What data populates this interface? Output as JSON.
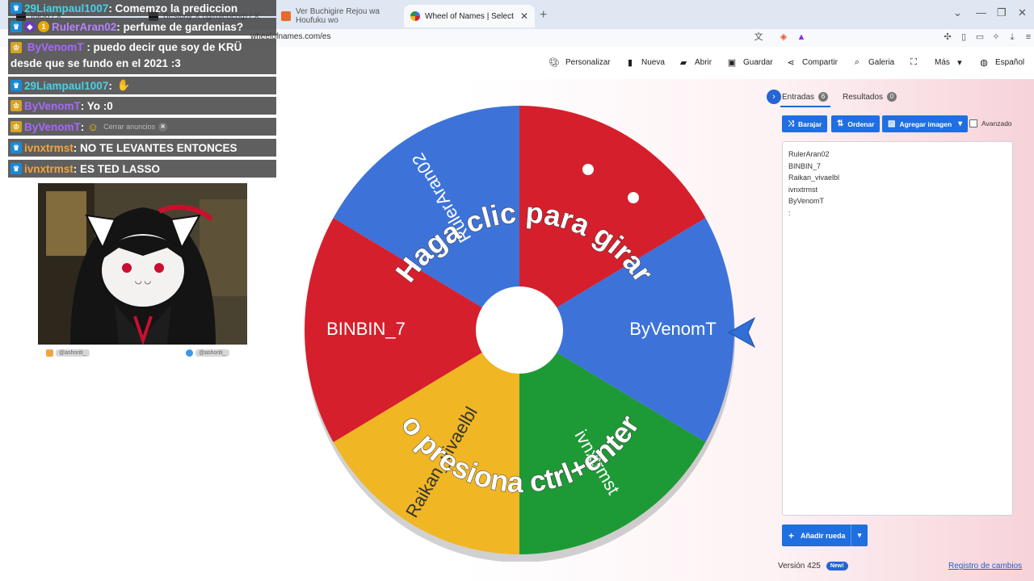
{
  "browser": {
    "tabs": [
      {
        "label": "Inicio / X",
        "active": false
      },
      {
        "label": "Bestboy X (@rolebeng) / X",
        "active": false
      },
      {
        "label": "Ver Buchigire Rejou wa Houfuku wo",
        "active": false
      },
      {
        "label": "Wheel of Names | Selector de n",
        "active": true
      }
    ],
    "url": "wheelofnames.com/es"
  },
  "nav": {
    "customize": "Personalizar",
    "new": "Nueva",
    "open": "Abrir",
    "save": "Guardar",
    "share": "Compartir",
    "gallery": "Galeria",
    "more": "Más",
    "language": "Español"
  },
  "wheel": {
    "overlay_line1": "Haga clic para girar",
    "overlay_line2": "o presiona ctrl+enter",
    "slices": [
      {
        "label": "RulerAran02",
        "color": "#3d73d9"
      },
      {
        "label": "",
        "color": "#d61f2c"
      },
      {
        "label": "ByVenomT",
        "color": "#3d73d9"
      },
      {
        "label": "ivnxtrmst",
        "color": "#1d9a35"
      },
      {
        "label": "Raikan_vivaelbl",
        "color": "#f0b623"
      },
      {
        "label": "BINBIN_7",
        "color": "#d61f2c"
      }
    ]
  },
  "panel": {
    "tab_entries": "Entradas",
    "entries_count": "6",
    "tab_results": "Resultados",
    "results_count": "0",
    "shuffle": "Barajar",
    "sort": "Ordenar",
    "add_image": "Agregar imagen",
    "advanced": "Avanzado",
    "entries": [
      "RulerAran02",
      "BINBIN_7",
      "Raikan_vivaelbl",
      "ivnxtrmst",
      "ByVenomT",
      ":"
    ],
    "add_wheel": "Añadir rueda",
    "version": "Versión 425",
    "new_badge": "New!",
    "changelog": "Registro de cambios"
  },
  "chat": [
    {
      "user": "29Liampaul1007",
      "text": ": Comemzo la prediccion",
      "color": "#46d3e6"
    },
    {
      "user": "RulerAran02",
      "text": ": perfume de gardenias?",
      "color": "#b783ff"
    },
    {
      "user": "ByVenomT",
      "text": ": puedo decir que soy de KRÜ desde que se fundo en el 2021 :3",
      "color": "#a768ff"
    },
    {
      "user": "29Liampaul1007",
      "text": ":",
      "color": "#46d3e6"
    },
    {
      "user": "ByVenomT",
      "text": ": Yo :0",
      "color": "#a768ff"
    },
    {
      "user": "ByVenomT",
      "text": ":",
      "color": "#a768ff"
    },
    {
      "user": "ivnxtrmst",
      "text": ": NO TE LEVANTES ENTONCES",
      "color": "#f4a43a"
    },
    {
      "user": "ivnxtrmst",
      "text": ": ES TED LASSO",
      "color": "#f4a43a"
    }
  ],
  "ad_close": "Cerrar anuncios",
  "socials": [
    {
      "handle": "@ashoriti_",
      "icon": "kofi-icon"
    },
    {
      "handle": "@ashoriti_",
      "icon": "twitter-icon"
    }
  ]
}
